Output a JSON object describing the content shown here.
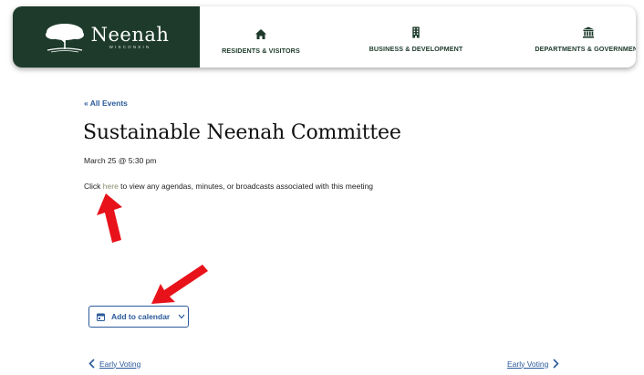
{
  "header": {
    "logo": {
      "name": "Neenah",
      "subtitle": "WISCONSIN",
      "icon": "tree-logo-icon"
    },
    "nav": [
      {
        "label": "RESIDENTS & VISITORS",
        "icon": "home-icon"
      },
      {
        "label": "BUSINESS & DEVELOPMENT",
        "icon": "building-icon"
      },
      {
        "label": "DEPARTMENTS & GOVERNMENT",
        "icon": "government-building-icon"
      }
    ],
    "brand_color": "#1d3a2b"
  },
  "event": {
    "back_link": "« All Events",
    "title": "Sustainable Neenah Committee",
    "date": "March 25 @ 5:30 pm",
    "desc_before": "Click ",
    "desc_link": "here",
    "desc_after": " to view any agendas, minutes, or broadcasts associated with this meeting"
  },
  "calendar_button": {
    "label": "Add to calendar",
    "icon": "calendar-icon",
    "chevron": "chevron-down-icon"
  },
  "pager": {
    "prev": {
      "label": "Early Voting",
      "icon": "chevron-left-icon"
    },
    "next": {
      "label": "Early Voting",
      "icon": "chevron-right-icon"
    }
  },
  "annotations": {
    "arrow_color": "#e8121a"
  },
  "link_color": "#2b5a9a"
}
